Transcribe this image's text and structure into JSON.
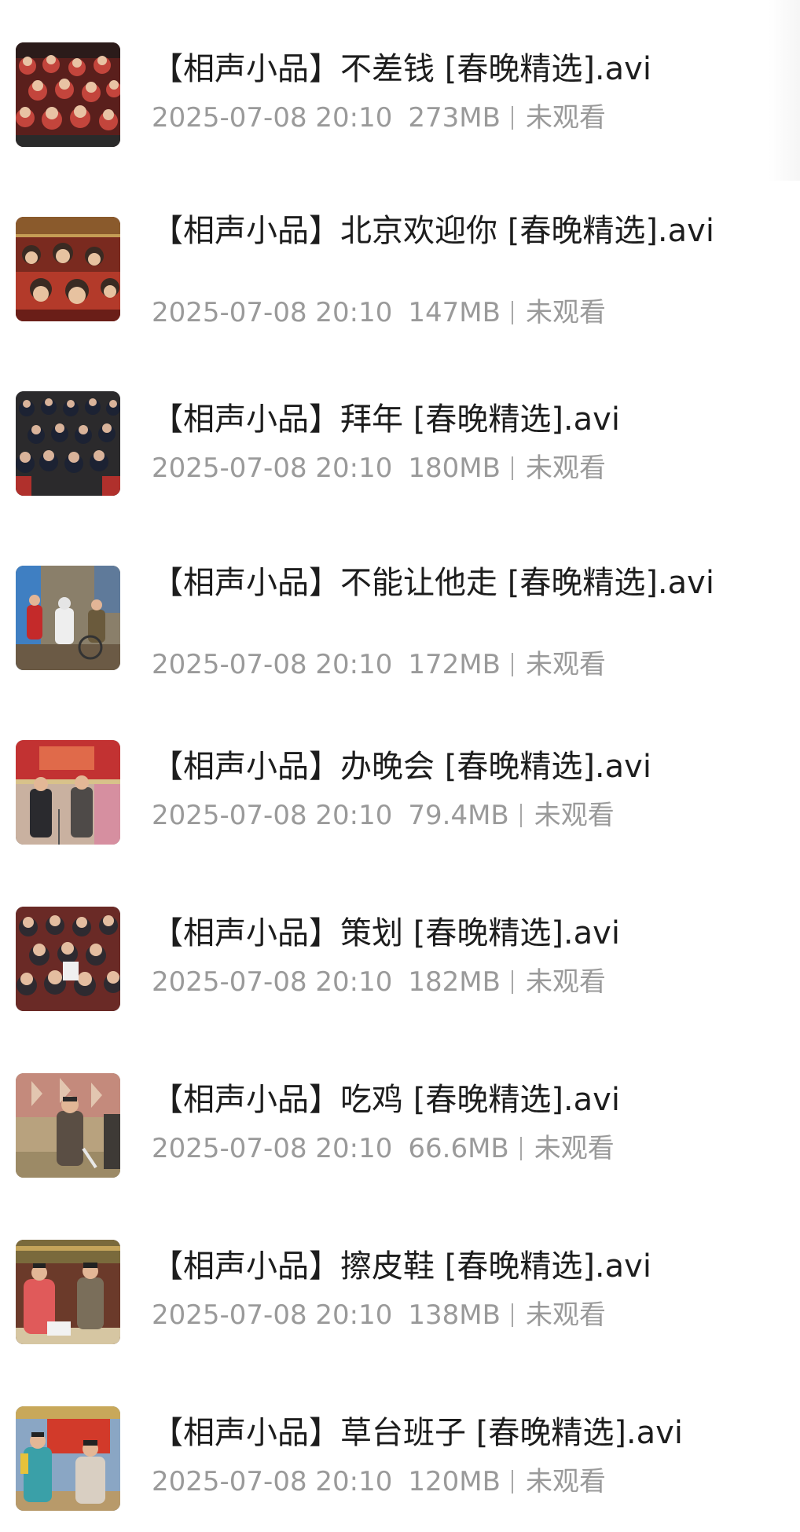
{
  "files": [
    {
      "name": "【相声小品】不差钱 [春晚精选].avi",
      "date": "2025-07-08 20:10",
      "size": "273MB",
      "status": "未观看",
      "thumb": "crowd-red-icon"
    },
    {
      "name": "【相声小品】北京欢迎你 [春晚精选].avi",
      "date": "2025-07-08 20:10",
      "size": "147MB",
      "status": "未观看",
      "thumb": "audience-laughing-icon"
    },
    {
      "name": "【相声小品】拜年 [春晚精选].avi",
      "date": "2025-07-08 20:10",
      "size": "180MB",
      "status": "未观看",
      "thumb": "audience-dark-icon"
    },
    {
      "name": "【相声小品】不能让他走 [春晚精选].avi",
      "date": "2025-07-08 20:10",
      "size": "172MB",
      "status": "未观看",
      "thumb": "stage-hospital-icon"
    },
    {
      "name": "【相声小品】办晚会 [春晚精选].avi",
      "date": "2025-07-08 20:10",
      "size": "79.4MB",
      "status": "未观看",
      "thumb": "stage-duo-icon"
    },
    {
      "name": "【相声小品】策划 [春晚精选].avi",
      "date": "2025-07-08 20:10",
      "size": "182MB",
      "status": "未观看",
      "thumb": "crowd-red-icon"
    },
    {
      "name": "【相声小品】吃鸡 [春晚精选].avi",
      "date": "2025-07-08 20:10",
      "size": "66.6MB",
      "status": "未观看",
      "thumb": "stage-pink-icon"
    },
    {
      "name": "【相声小品】擦皮鞋 [春晚精选].avi",
      "date": "2025-07-08 20:10",
      "size": "138MB",
      "status": "未观看",
      "thumb": "stage-redrobe-icon"
    },
    {
      "name": "【相声小品】草台班子 [春晚精选].avi",
      "date": "2025-07-08 20:10",
      "size": "120MB",
      "status": "未观看",
      "thumb": "stage-yellow-icon"
    }
  ],
  "colors": {
    "title": "#1d1d1d",
    "meta": "#9a9a9a",
    "background": "#ffffff"
  }
}
